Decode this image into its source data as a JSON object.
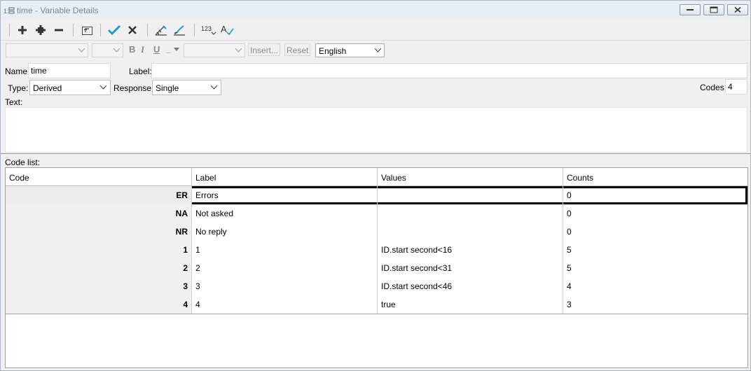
{
  "window": {
    "title": "time - Variable Details",
    "icons": [
      "minimize-icon",
      "maximize-icon",
      "close-icon"
    ]
  },
  "toolbar": {
    "buttons": [
      "add-icon",
      "add-multiple-icon",
      "remove-icon",
      "up-level-icon",
      "apply-check-icon",
      "cancel-x-icon",
      "edit-ruler-icon",
      "edit-brush-icon",
      "numbering-icon",
      "spellcheck-icon"
    ],
    "numbering_label": "123"
  },
  "format_bar": {
    "bold": "B",
    "italic": "I",
    "underline": "U",
    "insert_label": "Insert...",
    "reset_label": "Reset",
    "language": "English",
    "underline_indicator": "_"
  },
  "form": {
    "name_label": "Name:",
    "name_value": "time",
    "label_label": "Label:",
    "label_value": "",
    "type_label": "Type:",
    "type_value": "Derived",
    "response_label": "Response:",
    "response_value": "Single",
    "codes_label": "Codes:",
    "codes_value": "4",
    "text_label": "Text:",
    "code_list_label": "Code list:"
  },
  "grid": {
    "columns": [
      "Code",
      "Label",
      "Values",
      "Counts"
    ],
    "rows": [
      {
        "code": "ER",
        "label": "Errors",
        "values": "",
        "counts": "0"
      },
      {
        "code": "NA",
        "label": "Not asked",
        "values": "",
        "counts": "0"
      },
      {
        "code": "NR",
        "label": "No reply",
        "values": "",
        "counts": "0"
      },
      {
        "code": "1",
        "label": "1",
        "values": "ID.start second<16",
        "counts": "5"
      },
      {
        "code": "2",
        "label": "2",
        "values": "ID.start second<31",
        "counts": "5"
      },
      {
        "code": "3",
        "label": "3",
        "values": "ID.start second<46",
        "counts": "4"
      },
      {
        "code": "4",
        "label": "4",
        "values": "true",
        "counts": "3"
      }
    ],
    "selected_row": 0
  },
  "colors": {
    "accent_check": "#1e9bd7",
    "title_text": "#7a8594"
  }
}
